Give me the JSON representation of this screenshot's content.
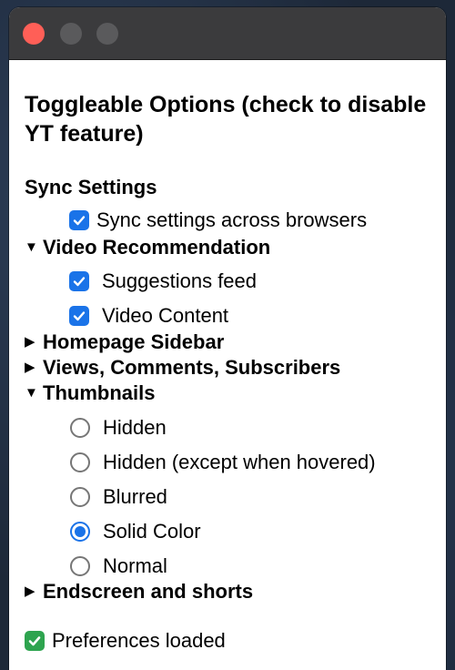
{
  "heading": "Toggleable Options (check to disable YT feature)",
  "sync": {
    "title": "Sync Settings",
    "option_label": "Sync settings across browsers",
    "checked": true
  },
  "video_recommendation": {
    "title": "Video Recommendation",
    "expanded": true,
    "options": [
      {
        "label": "Suggestions feed",
        "checked": true
      },
      {
        "label": "Video Content",
        "checked": true
      }
    ]
  },
  "homepage_sidebar": {
    "title": "Homepage Sidebar",
    "expanded": false
  },
  "views_comments": {
    "title": "Views, Comments, Subscribers",
    "expanded": false
  },
  "thumbnails": {
    "title": "Thumbnails",
    "expanded": true,
    "options": [
      {
        "label": "Hidden",
        "selected": false
      },
      {
        "label": "Hidden (except when hovered)",
        "selected": false
      },
      {
        "label": "Blurred",
        "selected": false
      },
      {
        "label": "Solid Color",
        "selected": true
      },
      {
        "label": "Normal",
        "selected": false
      }
    ]
  },
  "endscreen": {
    "title": "Endscreen and shorts",
    "expanded": false
  },
  "status": {
    "text": "Preferences loaded",
    "icon": "check-mark-icon"
  },
  "colors": {
    "accent": "#1a73e8",
    "status_green": "#2ea44f",
    "close_button": "#ff5f57"
  },
  "disclosure_icons": {
    "expanded": "▼",
    "collapsed": "▶"
  }
}
